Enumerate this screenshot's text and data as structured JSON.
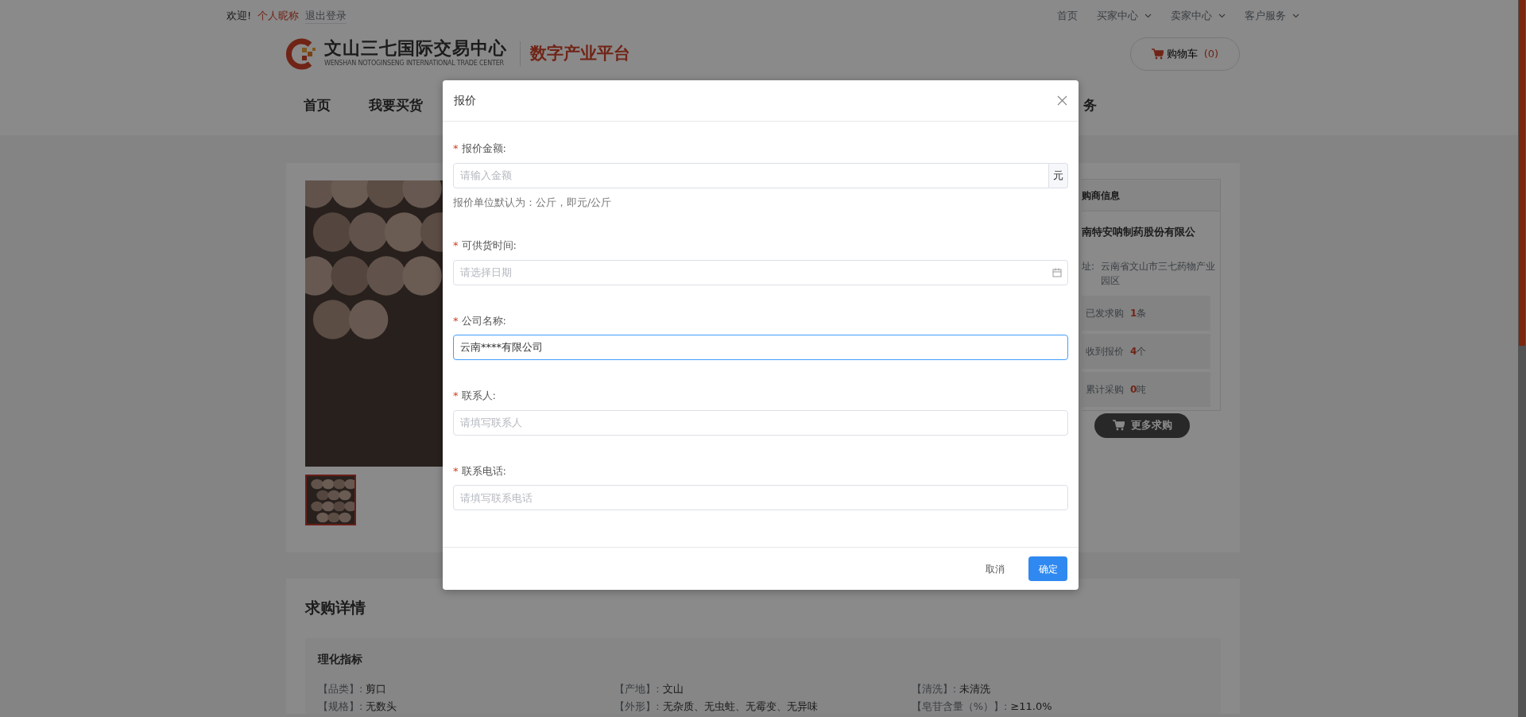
{
  "top_bar": {
    "greeting": "欢迎!",
    "nickname": "个人昵称",
    "logout": "退出登录",
    "links": [
      {
        "label": "首页",
        "dropdown": false
      },
      {
        "label": "买家中心",
        "dropdown": true
      },
      {
        "label": "卖家中心",
        "dropdown": true
      },
      {
        "label": "客户服务",
        "dropdown": true
      }
    ]
  },
  "header": {
    "logo_title": "文山三七国际交易中心",
    "logo_subtitle": "WENSHAN NOTOGINSENG INTERNATIONAL TRADE CENTER",
    "platform": "数字产业平台",
    "cart": {
      "label": "购物车",
      "count": "(0)"
    }
  },
  "nav": [
    {
      "label": "首页"
    },
    {
      "label": "我要买货"
    },
    {
      "label": "务"
    }
  ],
  "product": {
    "photo": {
      "kind": "picture"
    },
    "thumbnails": [
      {
        "kind": "picture",
        "selected": true
      }
    ]
  },
  "buyer_panel": {
    "title": "购商信息",
    "company": "南特安呐制药股份有限公",
    "address_label": "址:",
    "address": "云南省文山市三七药物产业园区",
    "stats": [
      {
        "label": "已发求购",
        "value": "1",
        "unit": "条"
      },
      {
        "label": "收到报价",
        "value": "4",
        "unit": "个"
      },
      {
        "label": "累计采购",
        "value": "0",
        "unit": "吨"
      }
    ],
    "more_button": "更多求购"
  },
  "details": {
    "title": "求购详情",
    "section": "理化指标",
    "specs": [
      {
        "label": "【品类】:",
        "value": "剪口"
      },
      {
        "label": "【产地】:",
        "value": "文山"
      },
      {
        "label": "【清洗】:",
        "value": "未清洗"
      },
      {
        "label": "【规格】:",
        "value": "无数头"
      },
      {
        "label": "【外形】:",
        "value": "无杂质、无虫蛀、无霉变、无异味"
      },
      {
        "label": "【皂苷含量（%）】:",
        "value": "≥11.0%"
      }
    ]
  },
  "dialog": {
    "title": "报价",
    "fields": [
      {
        "mark": "*",
        "label": "报价金额:",
        "kind": "amount",
        "placeholder": "请输入金额",
        "suffix": "元",
        "hint": "报价单位默认为：公斤，即元/公斤",
        "focused": false
      },
      {
        "mark": "*",
        "label": "可供货时间:",
        "kind": "date",
        "placeholder": "请选择日期",
        "focused": false
      },
      {
        "mark": "*",
        "label": "公司名称:",
        "kind": "text",
        "value": "云南****有限公司",
        "focused": true
      },
      {
        "mark": "*",
        "label": "联系人:",
        "kind": "text",
        "placeholder": "请填写联系人",
        "focused": false
      },
      {
        "mark": "*",
        "label": "联系电话:",
        "kind": "text",
        "placeholder": "请填写联系电话",
        "focused": false
      }
    ],
    "buttons": [
      {
        "label": "取消",
        "kind": "text"
      },
      {
        "label": "确定",
        "kind": "primary"
      }
    ]
  }
}
